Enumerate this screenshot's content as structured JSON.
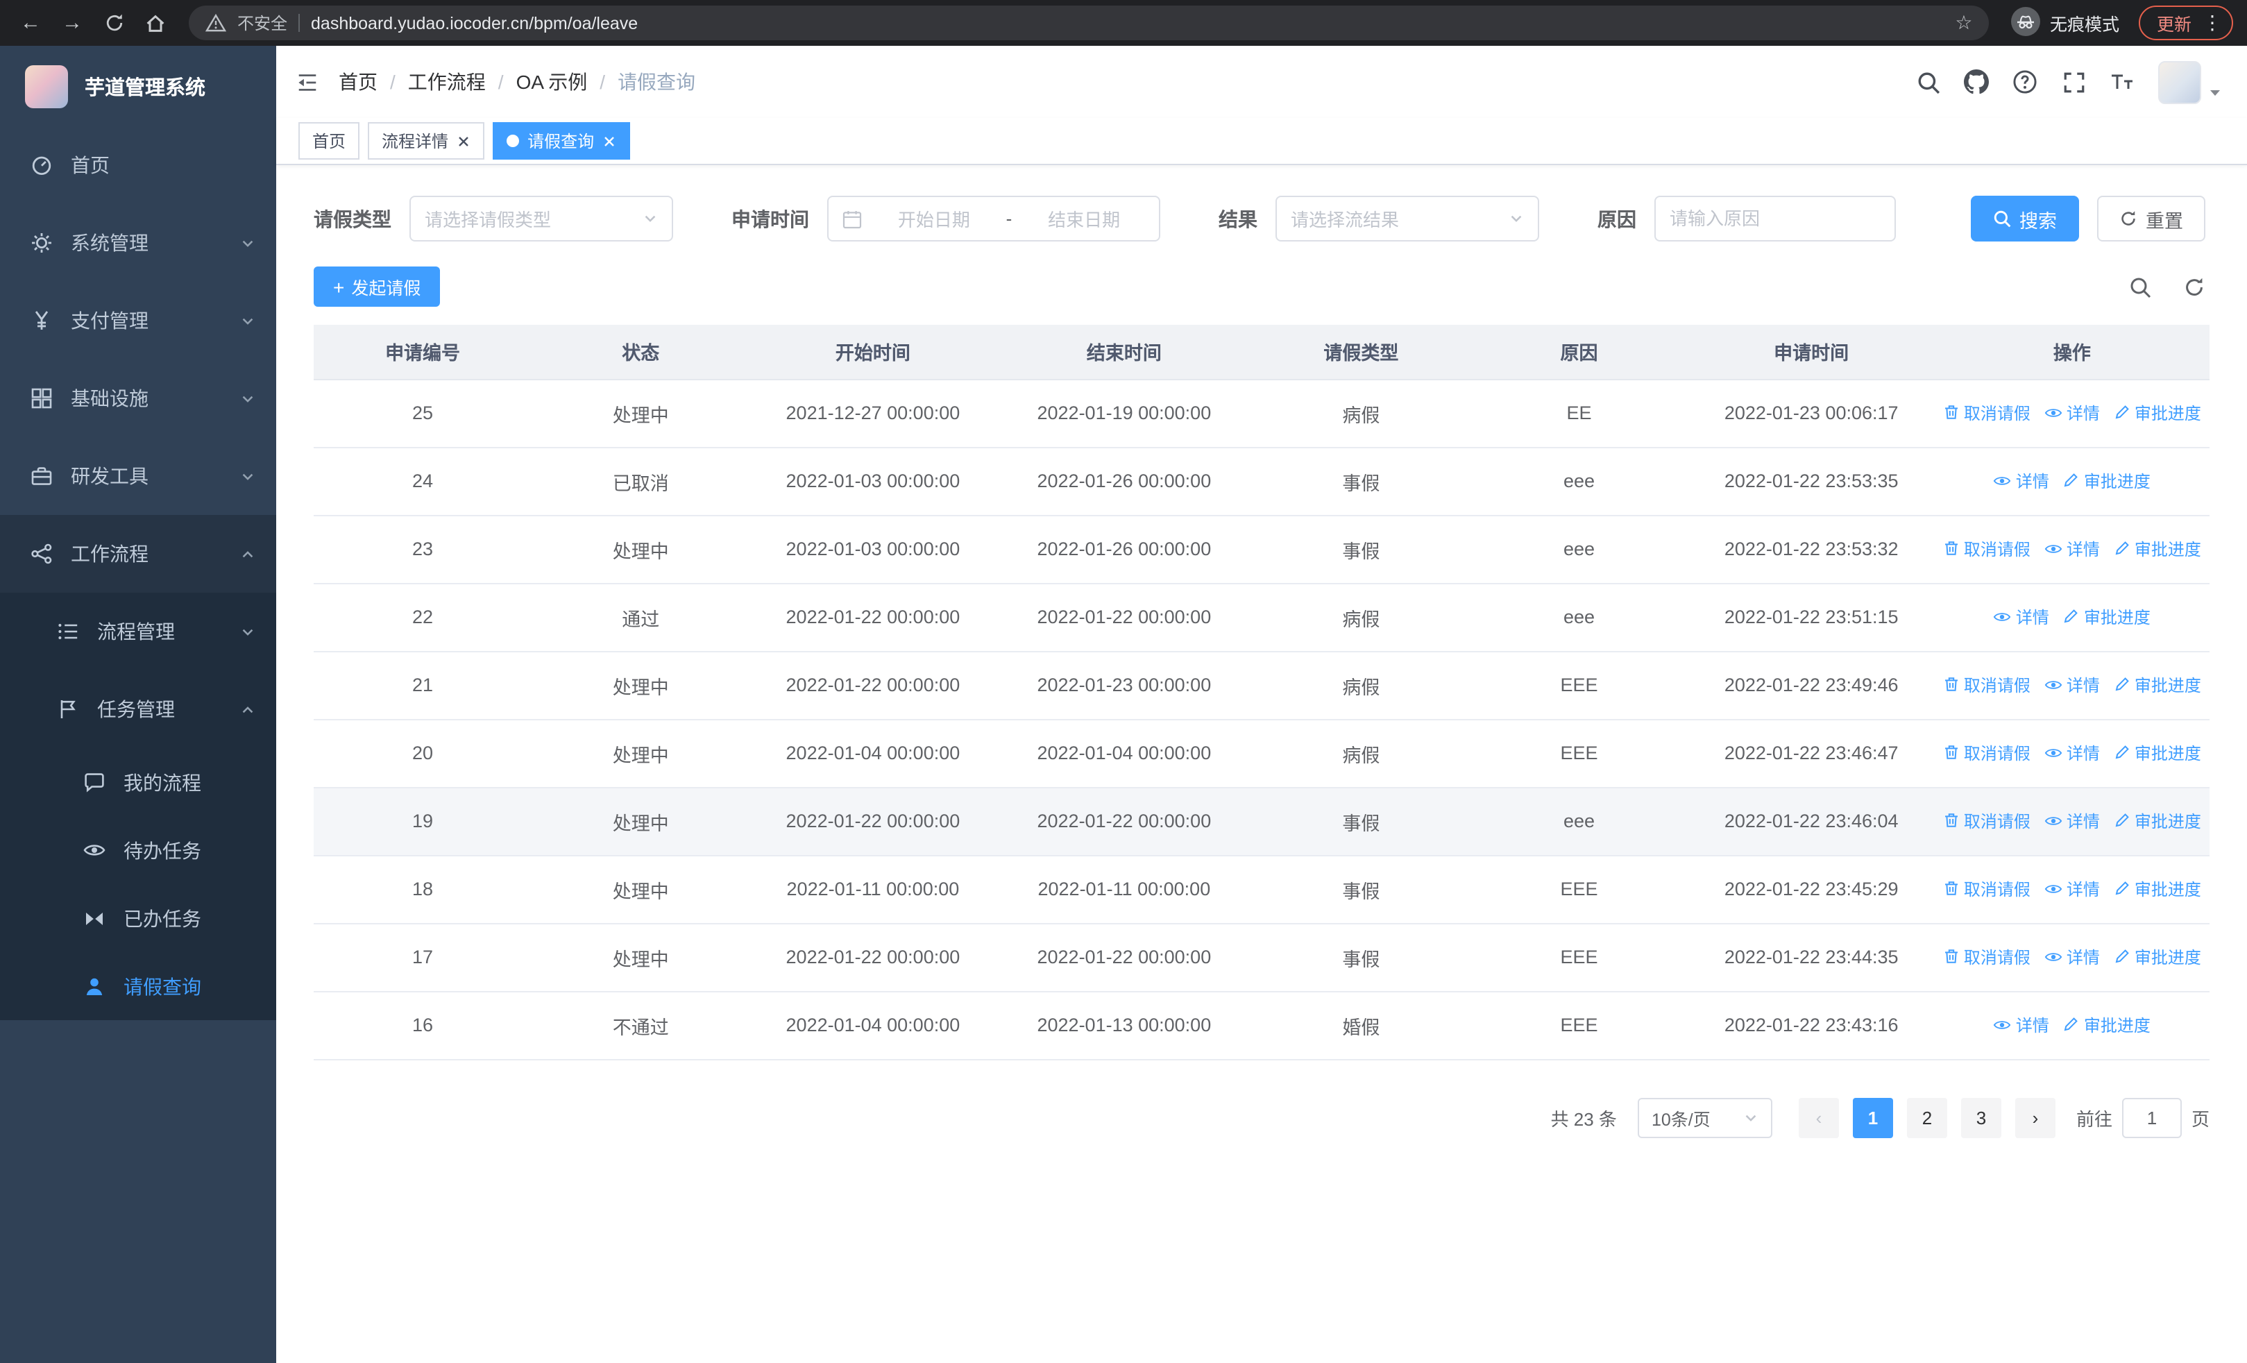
{
  "browser": {
    "security_label": "不安全",
    "url": "dashboard.yudao.iocoder.cn/bpm/oa/leave",
    "incognito_label": "无痕模式",
    "update_label": "更新"
  },
  "app": {
    "logo_title": "芋道管理系统"
  },
  "sidebar": {
    "items": [
      {
        "label": "首页",
        "icon": "dashboard-icon"
      },
      {
        "label": "系统管理",
        "icon": "gear-icon"
      },
      {
        "label": "支付管理",
        "icon": "yen-icon"
      },
      {
        "label": "基础设施",
        "icon": "infrastructure-icon"
      },
      {
        "label": "研发工具",
        "icon": "devtools-icon"
      },
      {
        "label": "工作流程",
        "icon": "workflow-icon"
      }
    ],
    "workflow_children": [
      {
        "label": "流程管理",
        "icon": "process-list-icon"
      },
      {
        "label": "任务管理",
        "icon": "task-flag-icon"
      }
    ],
    "task_children": [
      {
        "label": "我的流程",
        "icon": "chat-icon"
      },
      {
        "label": "待办任务",
        "icon": "eye-icon"
      },
      {
        "label": "已办任务",
        "icon": "done-tasks-icon"
      },
      {
        "label": "请假查询",
        "icon": "user-icon",
        "active": true
      }
    ]
  },
  "breadcrumb": {
    "separator": "/",
    "items": [
      "首页",
      "工作流程",
      "OA 示例",
      "请假查询"
    ]
  },
  "tabs": [
    {
      "label": "首页",
      "closable": false,
      "active": false
    },
    {
      "label": "流程详情",
      "closable": true,
      "active": false
    },
    {
      "label": "请假查询",
      "closable": true,
      "active": true
    }
  ],
  "filters": {
    "leave_type_label": "请假类型",
    "leave_type_placeholder": "请选择请假类型",
    "apply_time_label": "申请时间",
    "date_start_placeholder": "开始日期",
    "date_separator": "-",
    "date_end_placeholder": "结束日期",
    "result_label": "结果",
    "result_placeholder": "请选择流结果",
    "reason_label": "原因",
    "reason_placeholder": "请输入原因",
    "search_button": "搜索",
    "reset_button": "重置"
  },
  "toolbar": {
    "create_button": "发起请假"
  },
  "table": {
    "columns": [
      "申请编号",
      "状态",
      "开始时间",
      "结束时间",
      "请假类型",
      "原因",
      "申请时间",
      "操作"
    ],
    "action_labels": {
      "cancel": "取消请假",
      "detail": "详情",
      "progress": "审批进度"
    },
    "rows": [
      {
        "id": "25",
        "status": "处理中",
        "start": "2021-12-27 00:00:00",
        "end": "2022-01-19 00:00:00",
        "type": "病假",
        "reason": "EE",
        "applied": "2022-01-23 00:06:17",
        "actions": [
          "cancel",
          "detail",
          "progress"
        ]
      },
      {
        "id": "24",
        "status": "已取消",
        "start": "2022-01-03 00:00:00",
        "end": "2022-01-26 00:00:00",
        "type": "事假",
        "reason": "eee",
        "applied": "2022-01-22 23:53:35",
        "actions": [
          "detail",
          "progress"
        ]
      },
      {
        "id": "23",
        "status": "处理中",
        "start": "2022-01-03 00:00:00",
        "end": "2022-01-26 00:00:00",
        "type": "事假",
        "reason": "eee",
        "applied": "2022-01-22 23:53:32",
        "actions": [
          "cancel",
          "detail",
          "progress"
        ]
      },
      {
        "id": "22",
        "status": "通过",
        "start": "2022-01-22 00:00:00",
        "end": "2022-01-22 00:00:00",
        "type": "病假",
        "reason": "eee",
        "applied": "2022-01-22 23:51:15",
        "actions": [
          "detail",
          "progress"
        ]
      },
      {
        "id": "21",
        "status": "处理中",
        "start": "2022-01-22 00:00:00",
        "end": "2022-01-23 00:00:00",
        "type": "病假",
        "reason": "EEE",
        "applied": "2022-01-22 23:49:46",
        "actions": [
          "cancel",
          "detail",
          "progress"
        ]
      },
      {
        "id": "20",
        "status": "处理中",
        "start": "2022-01-04 00:00:00",
        "end": "2022-01-04 00:00:00",
        "type": "病假",
        "reason": "EEE",
        "applied": "2022-01-22 23:46:47",
        "actions": [
          "cancel",
          "detail",
          "progress"
        ]
      },
      {
        "id": "19",
        "status": "处理中",
        "start": "2022-01-22 00:00:00",
        "end": "2022-01-22 00:00:00",
        "type": "事假",
        "reason": "eee",
        "applied": "2022-01-22 23:46:04",
        "actions": [
          "cancel",
          "detail",
          "progress"
        ],
        "highlighted": true
      },
      {
        "id": "18",
        "status": "处理中",
        "start": "2022-01-11 00:00:00",
        "end": "2022-01-11 00:00:00",
        "type": "事假",
        "reason": "EEE",
        "applied": "2022-01-22 23:45:29",
        "actions": [
          "cancel",
          "detail",
          "progress"
        ]
      },
      {
        "id": "17",
        "status": "处理中",
        "start": "2022-01-22 00:00:00",
        "end": "2022-01-22 00:00:00",
        "type": "事假",
        "reason": "EEE",
        "applied": "2022-01-22 23:44:35",
        "actions": [
          "cancel",
          "detail",
          "progress"
        ]
      },
      {
        "id": "16",
        "status": "不通过",
        "start": "2022-01-04 00:00:00",
        "end": "2022-01-13 00:00:00",
        "type": "婚假",
        "reason": "EEE",
        "applied": "2022-01-22 23:43:16",
        "actions": [
          "detail",
          "progress"
        ]
      }
    ]
  },
  "pagination": {
    "total_text": "共 23 条",
    "page_size": "10条/页",
    "pages": [
      "1",
      "2",
      "3"
    ],
    "current_page": "1",
    "goto_label": "前往",
    "goto_value": "1",
    "goto_suffix": "页"
  },
  "colors": {
    "primary": "#409eff",
    "sidebar_bg": "#304156",
    "sidebar_submenu_bg": "#1f2d3d",
    "chrome_bg": "#202124",
    "table_header_bg": "#f0f2f5",
    "pager_bg": "#f4f4f5"
  }
}
